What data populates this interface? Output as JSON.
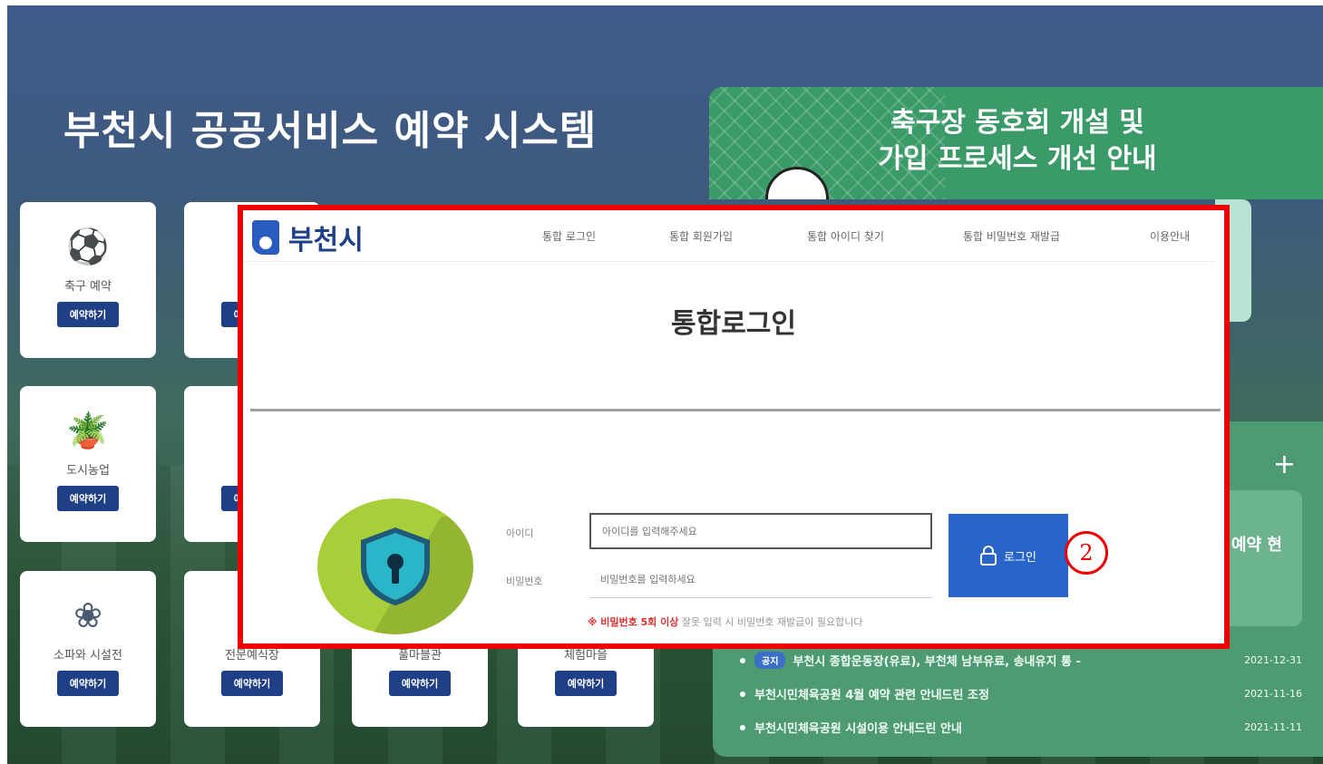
{
  "page": {
    "title": "부천시 공공서비스 예약 시스템"
  },
  "banner": {
    "line1": "축구장 동호회 개설 및",
    "line2": "가입 프로세스 개선 안내"
  },
  "tiles": [
    {
      "label": "축구 예약",
      "button": "예약하기",
      "icon": "soccer-ball-icon"
    },
    {
      "label": "",
      "button": "예약하기",
      "icon": "unknown-icon"
    },
    {
      "label": "도시농업",
      "button": "예약하기",
      "icon": "plant-pot-icon"
    },
    {
      "label": "",
      "button": "예약하기",
      "icon": "unknown-icon"
    },
    {
      "label": "소파와 시설전",
      "button": "예약하기",
      "icon": "fan-icon"
    },
    {
      "label": "전문예식장",
      "button": "예약하기",
      "icon": "building-icon"
    },
    {
      "label": "풀마블관",
      "button": "예약하기",
      "icon": "building-icon"
    },
    {
      "label": "체험마을",
      "button": "예약하기",
      "icon": "building-icon"
    }
  ],
  "news": {
    "plus": "+",
    "card_text": "예약 현",
    "items": [
      {
        "tag": "공지",
        "text": "부천시 종합운동장(유료), 부천체 남부유료, 송내유지 통 -",
        "date": "2021-12-31"
      },
      {
        "tag": "",
        "text": "부천시민체육공원 4월 예약 관련 안내드린 조정",
        "date": "2021-11-16"
      },
      {
        "tag": "",
        "text": "부천시민체육공원 시설이용 안내드린 안내",
        "date": "2021-11-11"
      }
    ]
  },
  "login_modal": {
    "logo": "부천시",
    "nav": [
      "통합 로그인",
      "통합 회원가입",
      "통합 아이디 찾기",
      "통합 비밀번호 재발급",
      "이용안내"
    ],
    "heading": "통합로그인",
    "id_label": "아이디",
    "id_placeholder": "아이디를 입력해주세요",
    "pw_label": "비밀번호",
    "pw_placeholder": "비밀번호를 입력하세요",
    "login_button": "로그인",
    "notice_prefix": "※",
    "notice_red": "비밀번호 5회 이상",
    "notice_rest": "잘못 입력 시 비밀번호 재발급이 필요합니다"
  },
  "annotation": {
    "badge": "2"
  }
}
